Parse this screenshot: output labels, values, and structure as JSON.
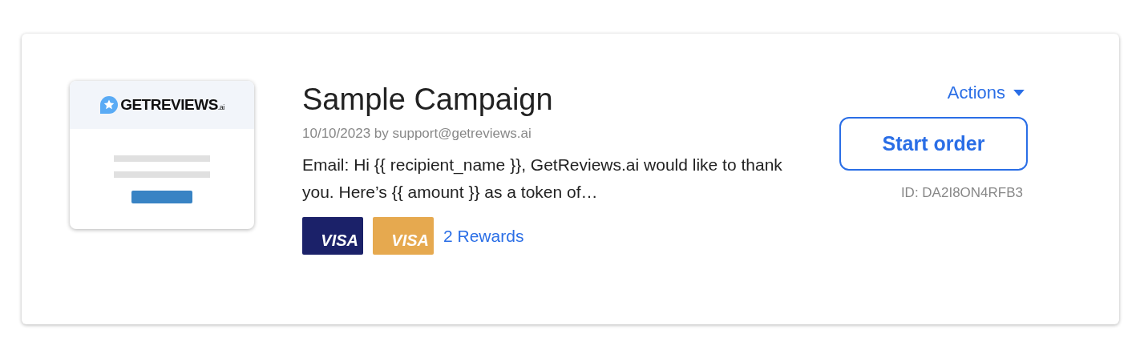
{
  "campaign": {
    "preview": {
      "logo_text": "GETREVIEWS",
      "logo_suffix": ".ai"
    },
    "title": "Sample Campaign",
    "meta": "10/10/2023 by support@getreviews.ai",
    "message": "Email: Hi {{ recipient_name }}, GetReviews.ai would like to thank you. Here’s {{ amount }} as a token of…",
    "rewards": [
      {
        "label": "VISA",
        "color": "#1b2169"
      },
      {
        "label": "VISA",
        "color": "#e6a94f"
      }
    ],
    "rewards_link": "2 Rewards",
    "actions": "Actions",
    "start_button": "Start order",
    "id": "ID: DA2I8ON4RFB3"
  }
}
